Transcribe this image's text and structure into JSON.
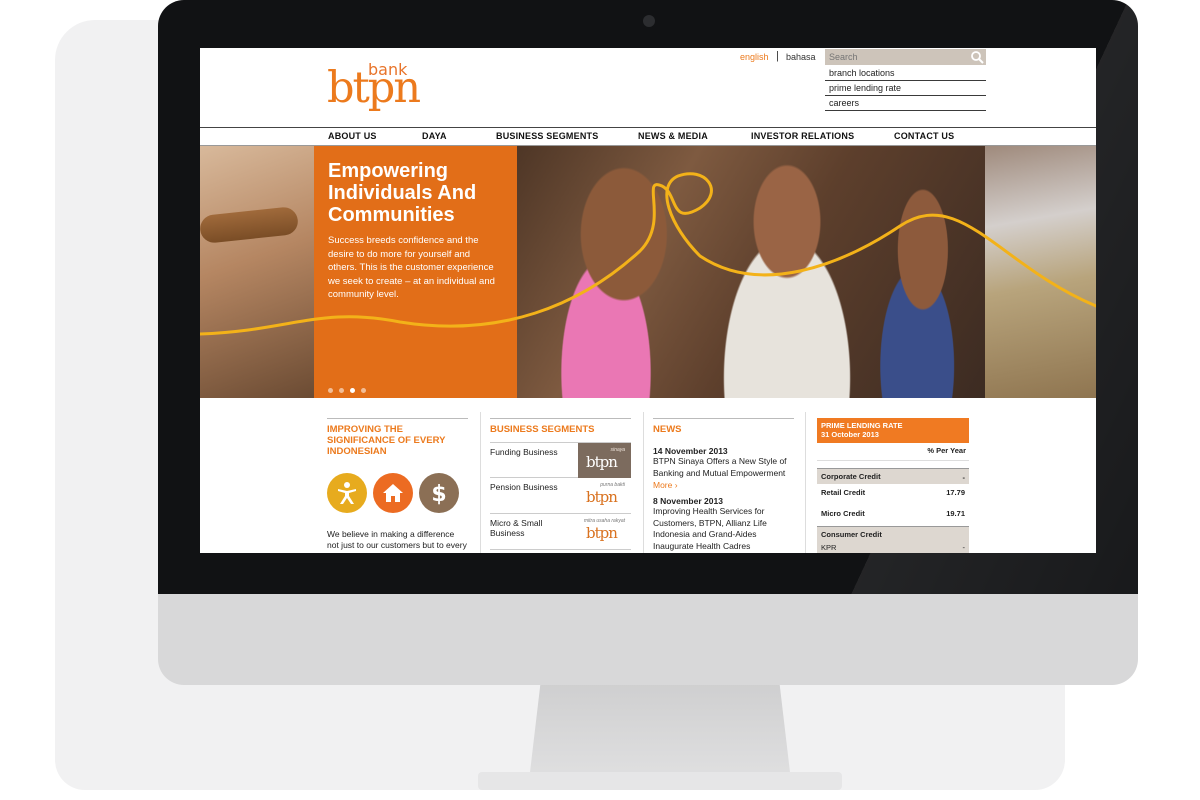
{
  "header": {
    "logo_bank": "bank",
    "logo_btpn": "btpn",
    "lang_english": "english",
    "lang_separator": "|",
    "lang_bahasa": "bahasa",
    "search_placeholder": "Search",
    "quick_links": [
      "branch locations",
      "prime lending rate",
      "careers"
    ]
  },
  "nav": {
    "items": [
      "ABOUT US",
      "DAYA",
      "BUSINESS SEGMENTS",
      "NEWS & MEDIA",
      "INVESTOR RELATIONS",
      "CONTACT US"
    ]
  },
  "hero": {
    "title": "Empowering Individuals And Communities",
    "text": "Success breeds confidence and the desire to do more for yourself and others. This is the customer experience we seek to create – at an individual and community level.",
    "slide_count": 4,
    "active_slide": 3
  },
  "improving": {
    "title": "IMPROVING THE SIGNIFICANCE OF EVERY INDONESIAN",
    "icons": [
      "person-icon",
      "house-icon",
      "dollar-icon"
    ],
    "text": "We believe in making a difference not just to our customers but to every"
  },
  "segments": {
    "title": "BUSINESS SEGMENTS",
    "items": [
      {
        "label": "Funding Business",
        "logo_small": "sinaya",
        "logo_big": "btpn"
      },
      {
        "label": "Pension Business",
        "logo_small": "purna bakti",
        "logo_big": "btpn"
      },
      {
        "label": "Micro & Small Business",
        "logo_small": "mitra usaha rakyat",
        "logo_big": "btpn"
      }
    ]
  },
  "news": {
    "title": "NEWS",
    "items": [
      {
        "date": "14 November 2013",
        "headline": "BTPN Sinaya Offers a New Style of Banking and Mutual Empowerment",
        "more": "More ›"
      },
      {
        "date": "8 November 2013",
        "headline": "Improving Health Services for Customers, BTPN, Allianz Life Indonesia and Grand-Aides Inaugurate Health Cadres"
      }
    ]
  },
  "rates": {
    "title": "PRIME LENDING RATE",
    "date": "31 October 2013",
    "unit": "% Per Year",
    "corporate_label": "Corporate Credit",
    "corporate_value": "-",
    "retail_label": "Retail Credit",
    "retail_value": "17.79",
    "micro_label": "Micro Credit",
    "micro_value": "19.71",
    "consumer_label": "Consumer Credit",
    "kpr_label": "KPR",
    "kpr_value": "-"
  },
  "colors": {
    "brand_orange": "#ec7a1d",
    "bezel": "#111214"
  }
}
